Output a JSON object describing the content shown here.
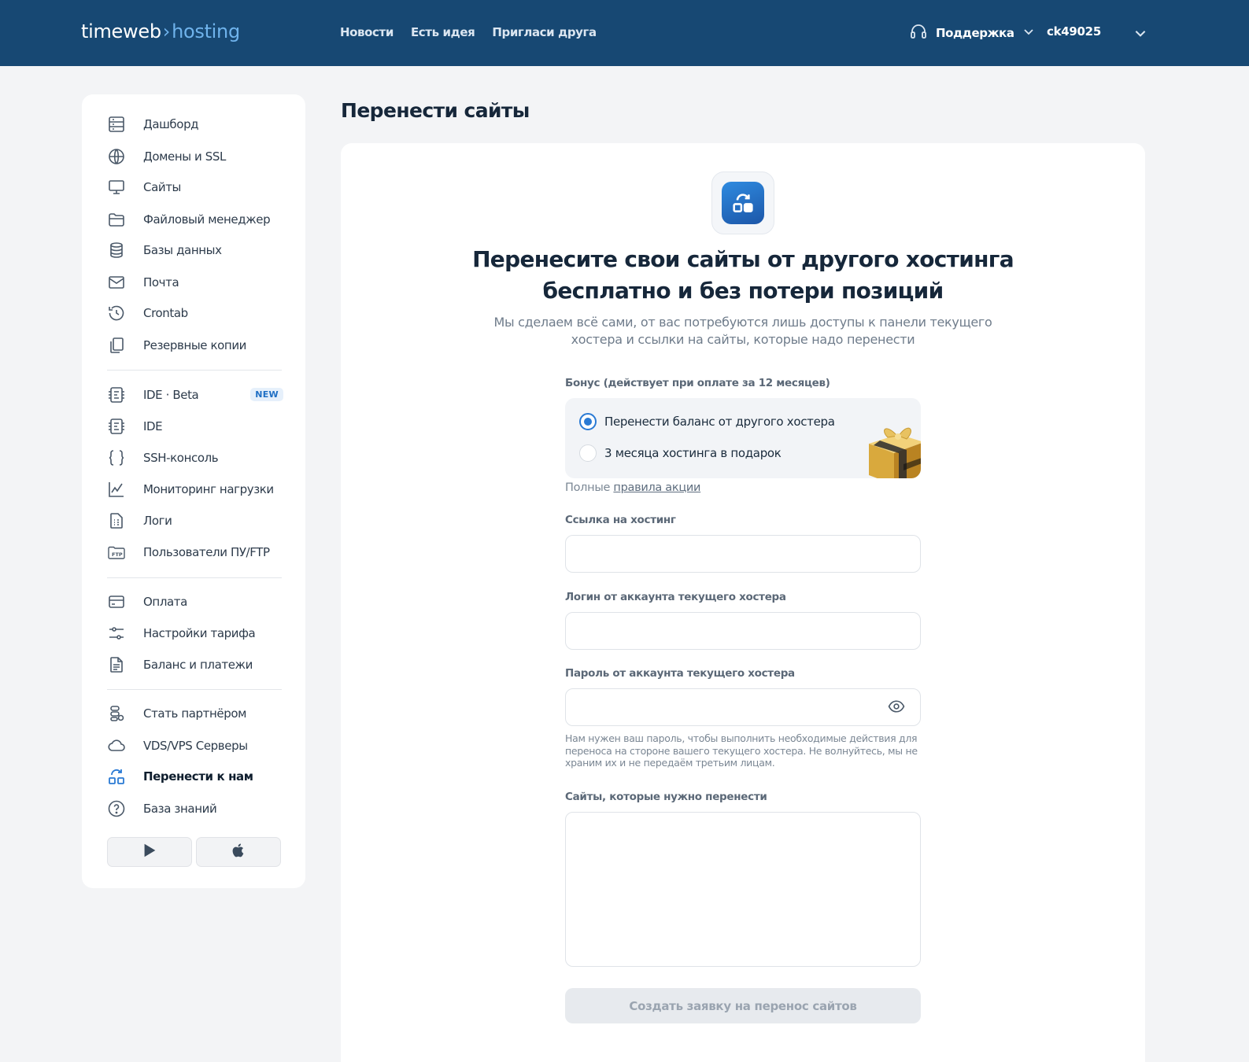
{
  "header": {
    "logo_main": "timeweb",
    "logo_sep": "›",
    "logo_sub": "hosting",
    "nav": [
      "Новости",
      "Есть идея",
      "Пригласи друга"
    ],
    "support_label": "Поддержка",
    "account": "ck49025"
  },
  "sidebar": {
    "items": [
      {
        "label": "Дашборд",
        "icon": "dashboard-icon"
      },
      {
        "label": "Домены и SSL",
        "icon": "globe-icon"
      },
      {
        "label": "Сайты",
        "icon": "monitor-icon"
      },
      {
        "label": "Файловый менеджер",
        "icon": "folder-icon"
      },
      {
        "label": "Базы данных",
        "icon": "database-icon"
      },
      {
        "label": "Почта",
        "icon": "mail-icon"
      },
      {
        "label": "Crontab",
        "icon": "history-icon"
      },
      {
        "label": "Резервные копии",
        "icon": "copy-icon"
      },
      {
        "label": "IDE · Beta",
        "icon": "ide-icon",
        "badge": "NEW"
      },
      {
        "label": "IDE",
        "icon": "ide-icon"
      },
      {
        "label": "SSH-консоль",
        "icon": "braces-icon"
      },
      {
        "label": "Мониторинг нагрузки",
        "icon": "chart-icon"
      },
      {
        "label": "Логи",
        "icon": "log-file-icon"
      },
      {
        "label": "Пользователи ПУ/FTP",
        "icon": "ftp-icon"
      },
      {
        "label": "Оплата",
        "icon": "card-icon"
      },
      {
        "label": "Настройки тарифа",
        "icon": "sliders-icon"
      },
      {
        "label": "Баланс и платежи",
        "icon": "document-icon"
      },
      {
        "label": "Стать партнёром",
        "icon": "partner-icon"
      },
      {
        "label": "VDS/VPS Серверы",
        "icon": "cloud-icon"
      },
      {
        "label": "Перенести к нам",
        "icon": "transfer-icon",
        "active": true
      },
      {
        "label": "База знаний",
        "icon": "question-icon"
      }
    ]
  },
  "page": {
    "title": "Перенести сайты",
    "hero_title_line1": "Перенесите свои сайты от другого хостинга",
    "hero_title_line2": "бесплатно и без потери позиций",
    "hero_sub_line1": "Мы сделаем всё сами, от вас потребуются лишь доступы к панели текущего",
    "hero_sub_line2": "хостера и ссылки на сайты, которые надо перенести"
  },
  "form": {
    "bonus_label": "Бонус (действует при оплате за 12 месяцев)",
    "bonus_options": [
      {
        "label": "Перенести баланс от другого хостера",
        "selected": true
      },
      {
        "label": "3 месяца хостинга в подарок",
        "selected": false
      }
    ],
    "rules_prefix": "Полные",
    "rules_link": "правила акции",
    "hosting_link_label": "Ссылка на хостинг",
    "hosting_link_value": "",
    "login_label": "Логин от аккаунта текущего хостера",
    "login_value": "",
    "password_label": "Пароль от аккаунта текущего хостера",
    "password_value": "",
    "password_hint": "Нам нужен ваш пароль, чтобы выполнить необходимые действия для переноса на стороне вашего текущего хостера. Не волнуйтесь, мы не храним их и не передаём третьим лицам.",
    "sites_label": "Сайты, которые нужно перенести",
    "sites_value": "",
    "submit_label": "Создать заявку на перенос сайтов"
  },
  "colors": {
    "header_bg": "#174873",
    "accent": "#2a7ad4",
    "page_bg": "#f3f4f6"
  }
}
